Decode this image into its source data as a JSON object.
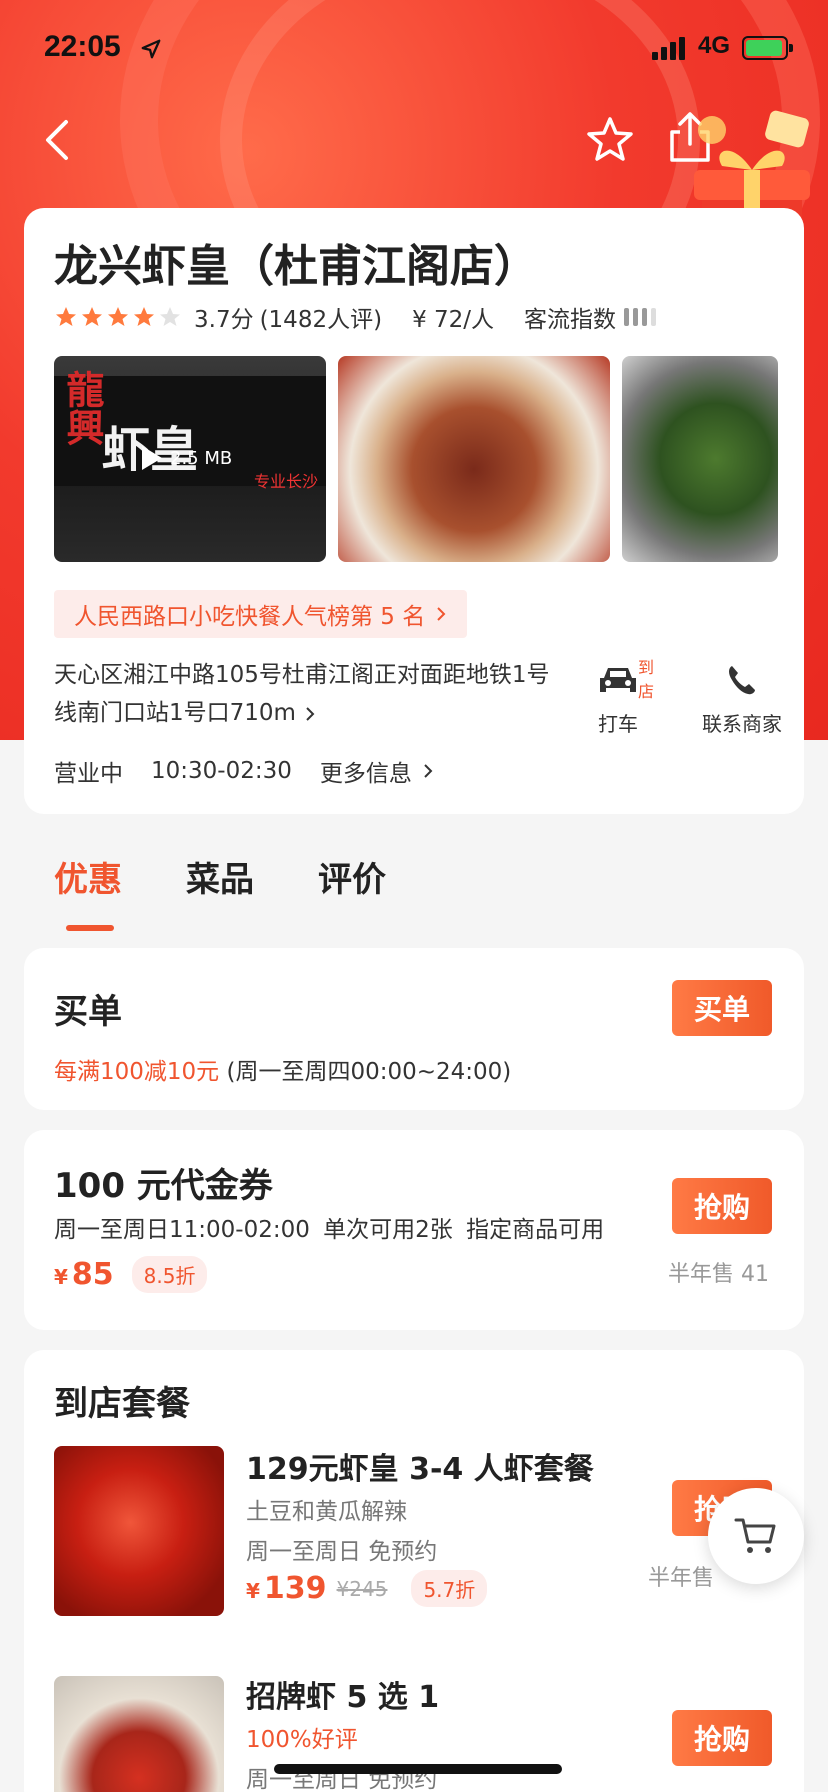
{
  "status": {
    "time": "22:05",
    "network": "4G"
  },
  "shop": {
    "name": "龙兴虾皇（杜甫江阁店）",
    "stars": 4,
    "score": "3.7分",
    "reviews": "(1482人评)",
    "avg_price": "¥ 72/人",
    "traffic_label": "客流指数",
    "video_size": "2.5 MB",
    "photo1_sign": "龍興",
    "photo1_logo": "虾皇",
    "photo1_slogan": "专业长沙",
    "rank": "人民西路口小吃快餐人气榜第 5 名",
    "address": "天心区湘江中路105号杜甫江阁正对面距地铁1号线南门口站1号口710m",
    "taxi_label": "打车",
    "taxi_badge": "到店",
    "call_label": "联系商家",
    "status": "营业中",
    "hours": "10:30-02:30",
    "more_info": "更多信息"
  },
  "tabs": [
    "优惠",
    "菜品",
    "评价"
  ],
  "pay": {
    "title": "买单",
    "button": "买单",
    "offer": "每满100减10元",
    "time": "(周一至周四00:00~24:00)"
  },
  "voucher": {
    "title": "100 元代金券",
    "meta": "周一至周日11:00-02:00 单次可用2张 指定商品可用",
    "yen": "¥",
    "price": "85",
    "discount": "8.5折",
    "button": "抢购",
    "sold": "半年售 41"
  },
  "combo": {
    "title": "到店套餐",
    "items": [
      {
        "name": "129元虾皇 3-4 人虾套餐",
        "line1": "土豆和黄瓜解辣",
        "line2": "周一至周日  免预约",
        "yen": "¥",
        "price": "139",
        "original": "¥245",
        "discount": "5.7折",
        "button": "抢购",
        "sold": "半年售"
      },
      {
        "name": "招牌虾 5 选 1",
        "line1": "100%好评",
        "line2": "周一至周日  免预约",
        "button": "抢购"
      }
    ]
  }
}
